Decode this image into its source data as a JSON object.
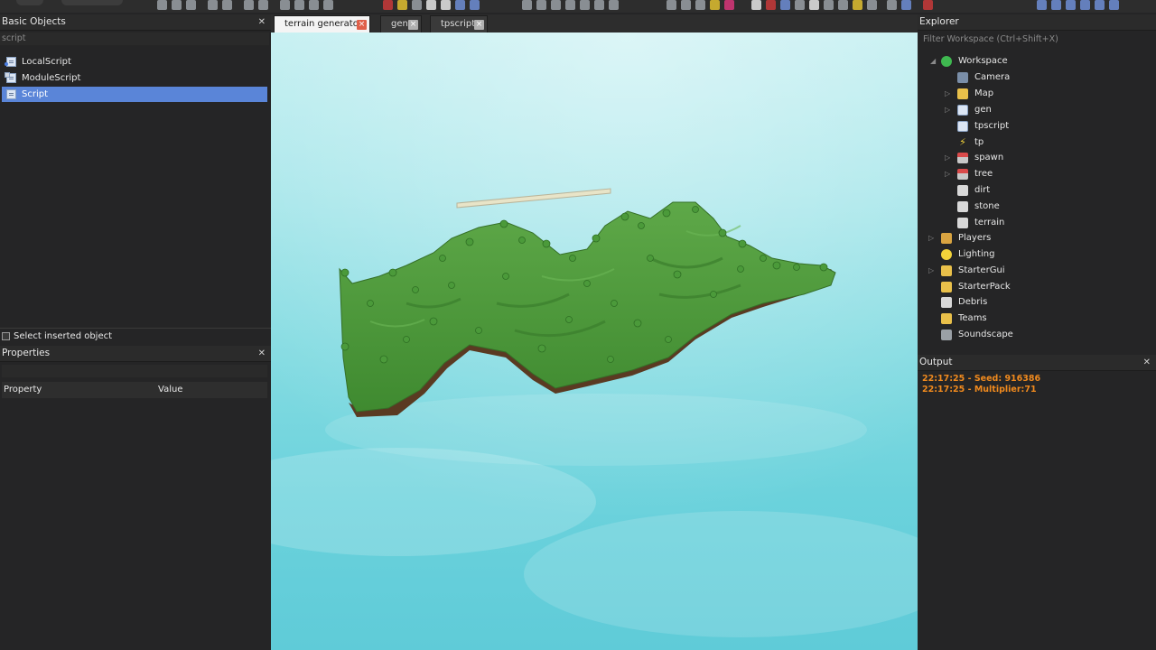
{
  "tabs": [
    {
      "label": "terrain generator",
      "active": true
    },
    {
      "label": "gen",
      "active": false
    },
    {
      "label": "tpscript",
      "active": false
    }
  ],
  "basic_objects": {
    "title": "Basic Objects",
    "filter_value": "script",
    "items": [
      {
        "label": "LocalScript",
        "icon": "localscript-icon"
      },
      {
        "label": "ModuleScript",
        "icon": "modulescript-icon"
      },
      {
        "label": "Script",
        "icon": "script-icon",
        "selected": true
      }
    ],
    "select_inserted_label": "Select inserted object"
  },
  "properties": {
    "title": "Properties",
    "col_property": "Property",
    "col_value": "Value"
  },
  "explorer": {
    "title": "Explorer",
    "filter_placeholder": "Filter Workspace (Ctrl+Shift+X)",
    "items": [
      {
        "label": "Workspace",
        "icon": "workspace-icon",
        "expanded": true
      },
      {
        "label": "Camera",
        "icon": "camera-icon"
      },
      {
        "label": "Map",
        "icon": "folder-icon",
        "expandable": true
      },
      {
        "label": "gen",
        "icon": "script-icon",
        "expandable": true
      },
      {
        "label": "tpscript",
        "icon": "script-icon"
      },
      {
        "label": "tp",
        "icon": "lightning-icon"
      },
      {
        "label": "spawn",
        "icon": "model-icon",
        "expandable": true
      },
      {
        "label": "tree",
        "icon": "model-icon",
        "expandable": true
      },
      {
        "label": "dirt",
        "icon": "part-icon"
      },
      {
        "label": "stone",
        "icon": "part-icon"
      },
      {
        "label": "terrain",
        "icon": "part-icon"
      },
      {
        "label": "Players",
        "icon": "players-icon",
        "expandable": true
      },
      {
        "label": "Lighting",
        "icon": "lightbulb-icon"
      },
      {
        "label": "StarterGui",
        "icon": "startergui-icon",
        "expandable": true
      },
      {
        "label": "StarterPack",
        "icon": "starterpack-icon"
      },
      {
        "label": "Debris",
        "icon": "debris-icon"
      },
      {
        "label": "Teams",
        "icon": "teams-icon"
      },
      {
        "label": "Soundscape",
        "icon": "soundscape-icon"
      }
    ]
  },
  "output": {
    "title": "Output",
    "lines": [
      "22:17:25 - Seed: 916386",
      "22:17:25 - Multiplier:71"
    ]
  },
  "colors": {
    "accent_selection": "#5a85d8",
    "output_text": "#f08a1e",
    "sky": "#6bd2dc",
    "grass": "#4f9a3c",
    "dirt": "#5a3a22"
  }
}
